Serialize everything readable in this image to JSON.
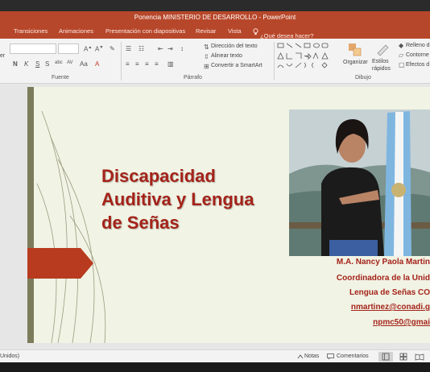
{
  "window": {
    "title": "Ponencia MINISTERIO DE DESARROLLO - PowerPoint",
    "accent": "#b7472a"
  },
  "tabs": [
    {
      "label": "Transiciones"
    },
    {
      "label": "Animaciones"
    },
    {
      "label": "Presentación con diapositivas"
    },
    {
      "label": "Revisar"
    },
    {
      "label": "Vista"
    }
  ],
  "tell_me": {
    "label": "¿Qué desea hacer?",
    "icon": "lightbulb-icon"
  },
  "ribbon": {
    "font_group": {
      "label": "Fuente",
      "cut_letter": "er"
    },
    "paragraph_group": {
      "label": "Párrafo",
      "text_direction": "Dirección del texto",
      "align_text": "Alinear texto",
      "smartart": "Convertir a SmartArt"
    },
    "drawing_group": {
      "label": "Dibujo",
      "arrange": "Organizar",
      "quick_styles": "Estilos rápidos",
      "shape_fill": "Relleno d",
      "shape_outline": "Contorne",
      "shape_effects": "Efectos d"
    }
  },
  "slide": {
    "title": "Discapacidad\nAuditiva y Lengua\nde Señas",
    "title_color": "#a4231a",
    "info_lines": [
      {
        "text": "M.A. Nancy Paola Martin"
      },
      {
        "text": "Coordinadora de la Unid"
      },
      {
        "text": "Lengua de Señas CO"
      },
      {
        "text": "nmartinez@conadi.g"
      },
      {
        "text": "npmc50@gmai"
      }
    ]
  },
  "status": {
    "language": "Unidos)",
    "notes": "Notas",
    "comments": "Comentarios"
  }
}
